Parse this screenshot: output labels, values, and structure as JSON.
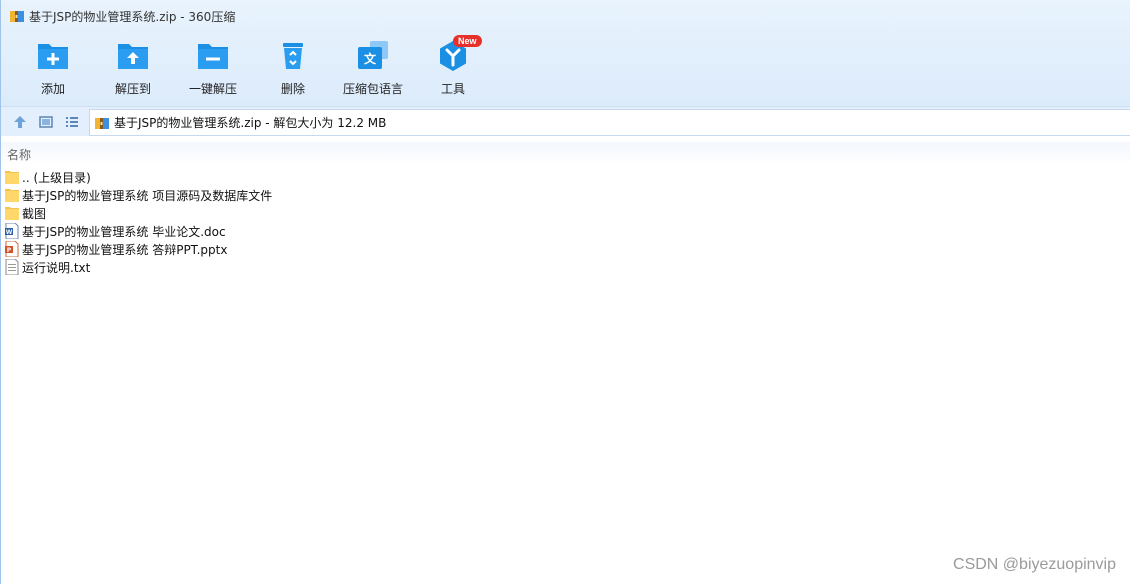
{
  "window": {
    "title": "基于JSP的物业管理系统.zip - 360压缩",
    "app_icon": "zip-archive-icon"
  },
  "toolbar": {
    "items": [
      {
        "label": "添加",
        "icon": "add-folder-icon"
      },
      {
        "label": "解压到",
        "icon": "extract-to-icon"
      },
      {
        "label": "一键解压",
        "icon": "one-click-extract-icon"
      },
      {
        "label": "删除",
        "icon": "recycle-bin-icon"
      },
      {
        "label": "压缩包语言",
        "icon": "archive-language-icon"
      },
      {
        "label": "工具",
        "icon": "tools-icon",
        "badge": "New"
      }
    ]
  },
  "navbar": {
    "up_icon": "up-arrow-icon",
    "view_icon": "thumbnail-view-icon",
    "list_icon": "list-view-icon",
    "address": "基于JSP的物业管理系统.zip - 解包大小为 12.2 MB"
  },
  "columns": {
    "name": "名称"
  },
  "files": [
    {
      "name": ".. (上级目录)",
      "type": "folder",
      "icon": "folder-icon"
    },
    {
      "name": "基于JSP的物业管理系统 项目源码及数据库文件",
      "type": "folder",
      "icon": "folder-icon"
    },
    {
      "name": "截图",
      "type": "folder",
      "icon": "folder-icon"
    },
    {
      "name": "基于JSP的物业管理系统 毕业论文.doc",
      "type": "doc",
      "icon": "word-doc-icon"
    },
    {
      "name": "基于JSP的物业管理系统 答辩PPT.pptx",
      "type": "pptx",
      "icon": "powerpoint-icon"
    },
    {
      "name": "运行说明.txt",
      "type": "txt",
      "icon": "text-file-icon"
    }
  ],
  "watermark": "CSDN @biyezuopinvip",
  "colors": {
    "accent": "#1a8fe3",
    "badge": "#e8302a",
    "folder": "#ffd76b"
  }
}
